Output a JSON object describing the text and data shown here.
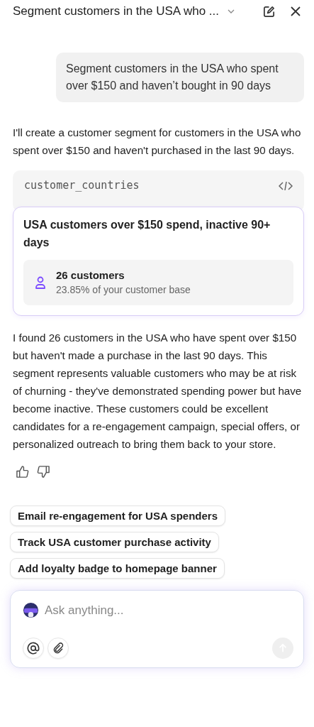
{
  "header": {
    "title": "Segment customers in the USA who ..."
  },
  "messages": [
    {
      "kind": "user",
      "text": "Segment customers in the USA who spent over $150 and haven’t bought in 90 days"
    },
    {
      "kind": "assistant",
      "text": "I'll create a customer segment for customers in the USA who spent over $150 and haven't purchased in the last 90 days."
    },
    {
      "kind": "code",
      "text": "customer_countries"
    },
    {
      "kind": "segment",
      "title": "USA customers over $150 spend, inactive 90+ days",
      "count": "26 customers",
      "share": "23.85% of your customer base"
    },
    {
      "kind": "assistant",
      "text": "I found 26 customers in the USA who have spent over $150 but haven't made a purchase in the last 90 days. This segment represents valuable customers who may be at risk of churning - they've demonstrated spending power but have become inactive. These customers could be excellent candidates for a re-engagement campaign, special offers, or personalized outreach to bring them back to your store."
    }
  ],
  "suggestions": [
    "Email re-engagement for USA spenders",
    "Track USA customer purchase activity",
    "Add loyalty badge to homepage banner"
  ],
  "composer": {
    "placeholder": "Ask anything..."
  }
}
